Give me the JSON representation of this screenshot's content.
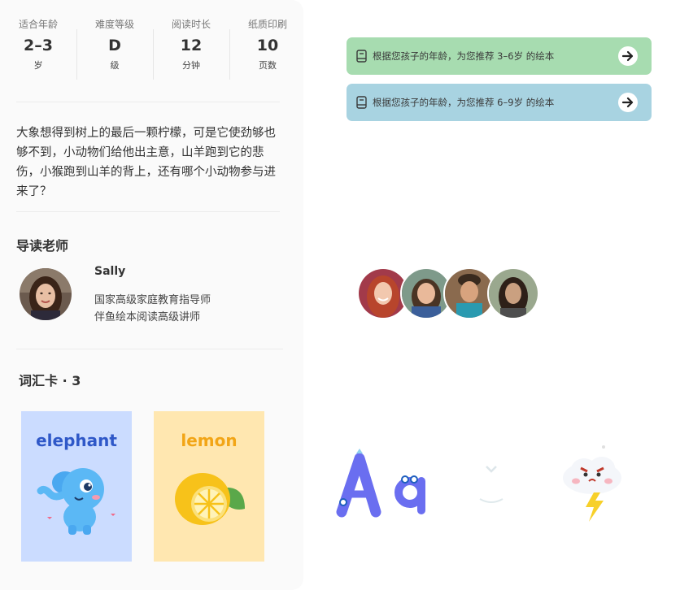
{
  "stats": [
    {
      "label": "适合年龄",
      "value": "2–3",
      "unit": "岁"
    },
    {
      "label": "难度等级",
      "value": "D",
      "unit": "级"
    },
    {
      "label": "阅读时长",
      "value": "12",
      "unit": "分钟"
    },
    {
      "label": "纸质印刷",
      "value": "10",
      "unit": "页数"
    }
  ],
  "description": "大象想得到树上的最后一颗柠檬，可是它使劲够也够不到，小动物们给他出主意，山羊跑到它的悲伤，小猴跑到山羊的背上，还有哪个小动物参与进来了？",
  "teacher": {
    "section_title": "导读老师",
    "name": "Sally",
    "titles": [
      "国家高级家庭教育指导师",
      "伴鱼绘本阅读高级讲师"
    ]
  },
  "vocab": {
    "section_title": "词汇卡 · 3",
    "cards": [
      {
        "word": "elephant",
        "bg": "#cbdcff",
        "word_color": "#2f58c8"
      },
      {
        "word": "lemon",
        "bg": "#ffe7b0",
        "word_color": "#f2a516"
      }
    ]
  },
  "banners": [
    {
      "text": "根据您孩子的年龄，为您推荐 3–6岁 的绘本",
      "bg": "#a7dcb0",
      "icon": "book-icon",
      "action_icon": "arrow-right-icon"
    },
    {
      "text": "根据您孩子的年龄，为您推荐 6–9岁 的绘本",
      "bg": "#a8d3e1",
      "icon": "book-icon",
      "action_icon": "arrow-right-icon"
    }
  ],
  "colors": {
    "card_bg": "#fafafa",
    "divider": "#ececec"
  }
}
